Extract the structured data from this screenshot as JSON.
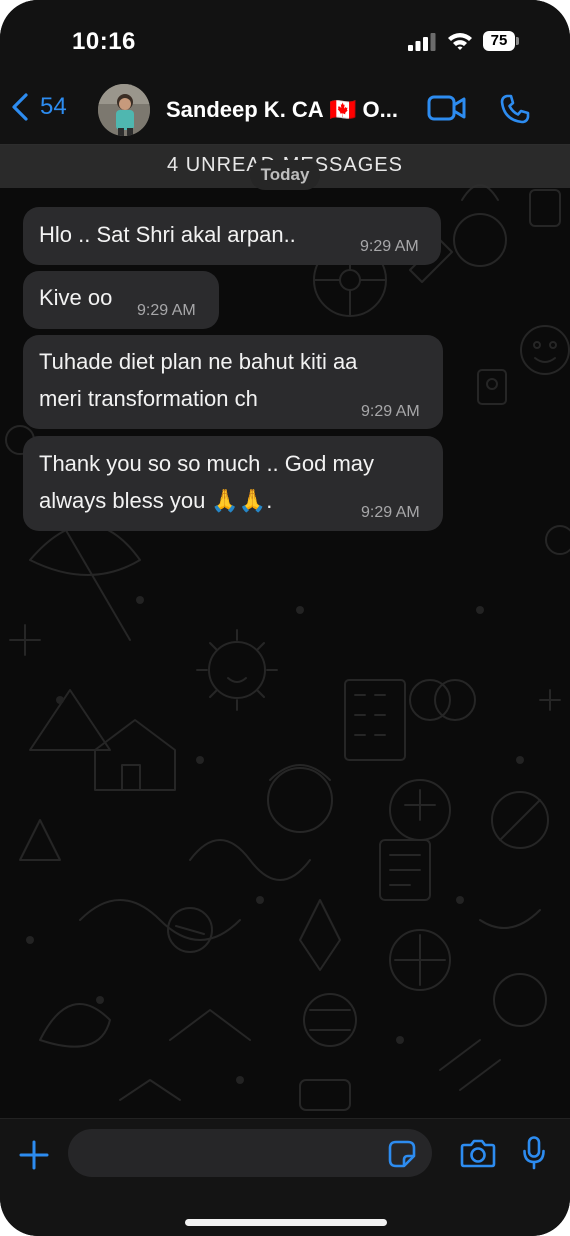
{
  "status_bar": {
    "time": "10:16",
    "battery": "75"
  },
  "header": {
    "back_count": "54",
    "contact_name": "Sandeep K. CA 🇨🇦 O..."
  },
  "chat": {
    "unread_banner": "4 UNREAD MESSAGES",
    "date_pill": "Today",
    "messages": [
      {
        "lines": [
          "Hlo .. Sat Shri akal arpan.."
        ],
        "time": "9:29 AM"
      },
      {
        "lines": [
          "Kive oo"
        ],
        "time": "9:29 AM"
      },
      {
        "lines": [
          "Tuhade diet plan ne bahut kiti aa",
          "meri transformation ch"
        ],
        "time": "9:29 AM"
      },
      {
        "lines": [
          "Thank you so so much .. God may",
          "always bless you 🙏🙏."
        ],
        "time": "9:29 AM"
      }
    ]
  },
  "composer": {
    "placeholder": ""
  },
  "icons": {
    "back": "chevron-left-icon",
    "video": "video-camera-icon",
    "call": "phone-icon",
    "attach": "plus-icon",
    "sticker": "sticker-icon",
    "camera": "camera-icon",
    "mic": "microphone-icon"
  },
  "colors": {
    "accent": "#2d8cf0",
    "background": "#0b0b0b",
    "bubble": "#2b2b2d",
    "timestamp": "#a7a7a9"
  }
}
